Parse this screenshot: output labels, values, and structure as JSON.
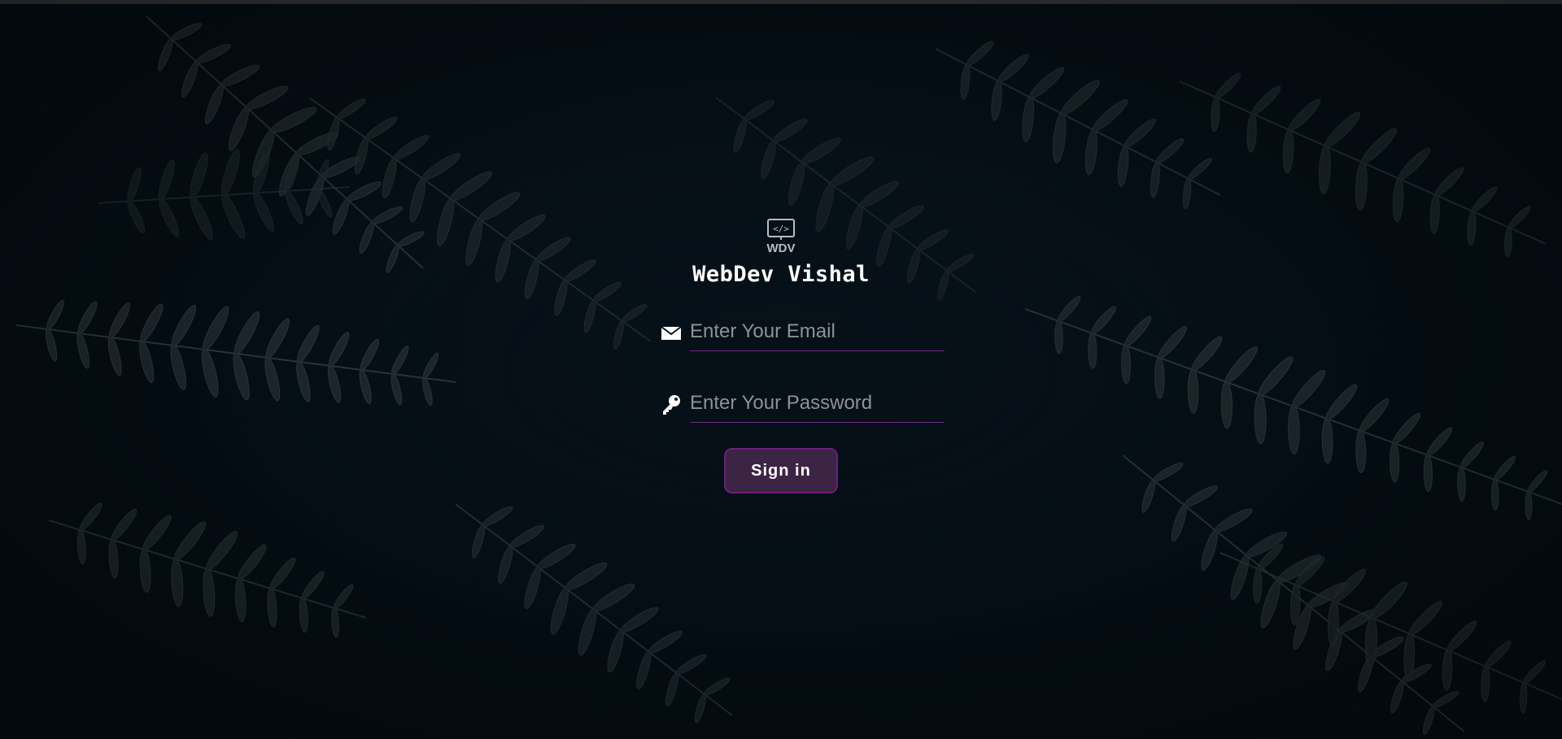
{
  "brand": {
    "logo_text": "WDV",
    "logo_code": "</>",
    "name": "WebDev Vishal"
  },
  "form": {
    "email": {
      "icon": "envelope-icon",
      "placeholder": "Enter Your Email",
      "value": ""
    },
    "password": {
      "icon": "key-icon",
      "placeholder": "Enter Your Password",
      "value": ""
    },
    "submit_label": "Sign in"
  },
  "colors": {
    "background": "#07121a",
    "underline": "#6d2a86",
    "button_bg": "#3b2444",
    "button_border": "#6c1f7c",
    "text": "#ffffff",
    "placeholder": "#8e9297"
  }
}
